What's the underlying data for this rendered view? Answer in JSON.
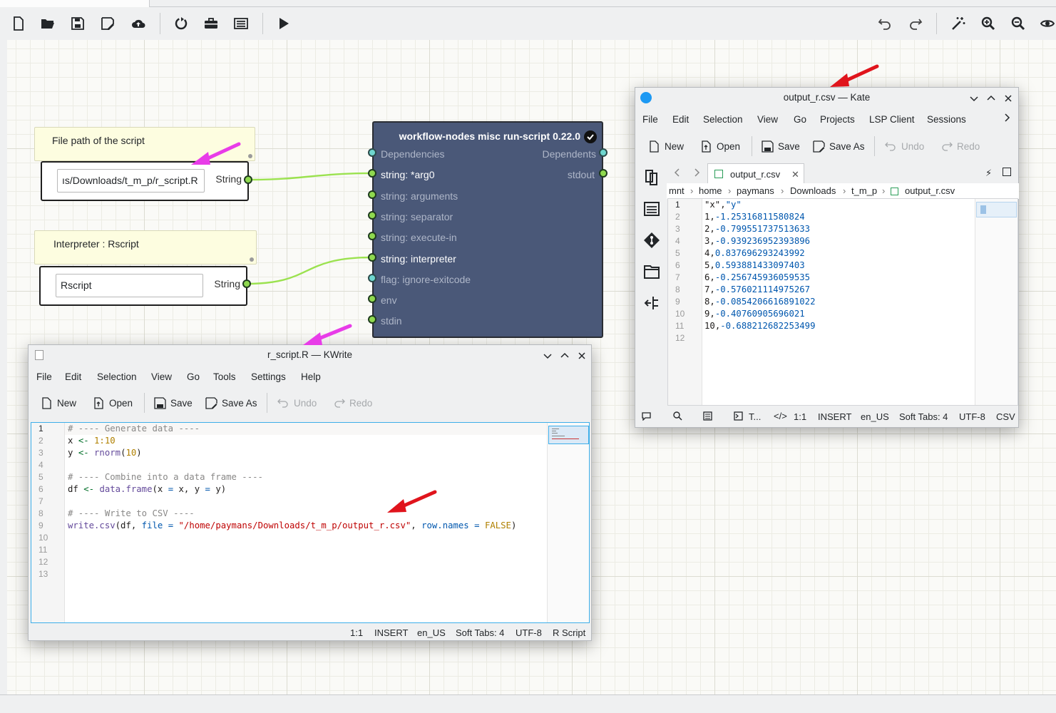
{
  "toolbar": {
    "left_icons": [
      "new-file-icon",
      "open-folder-icon",
      "save-icon",
      "save-as-icon",
      "upload-cloud-icon",
      "restart-icon",
      "toolbox-icon",
      "list-icon",
      "run-icon"
    ],
    "right_icons": [
      "undo-icon",
      "redo-icon",
      "magic-wand-icon",
      "zoom-in-icon",
      "zoom-out-icon",
      "visibility-icon"
    ]
  },
  "notes": {
    "script_path": "File path of the script",
    "interpreter": "Interpreter : Rscript"
  },
  "string_nodes": {
    "path_value": "ıs/Downloads/t_m_p/r_script.R",
    "path_type": "String",
    "interp_value": "Rscript",
    "interp_type": "String"
  },
  "run_script_node": {
    "title": "workflow-nodes misc run-script 0.22.0",
    "inputs": [
      "Dependencies",
      "string: *arg0",
      "string: arguments",
      "string: separator",
      "string: execute-in",
      "string: interpreter",
      "flag: ignore-exitcode",
      "env",
      "stdin"
    ],
    "outputs": [
      "Dependents",
      "stdout"
    ]
  },
  "kwrite": {
    "title": "r_script.R — KWrite",
    "menu": [
      "File",
      "Edit",
      "Selection",
      "View",
      "Go",
      "Tools",
      "Settings",
      "Help"
    ],
    "tools": [
      "New",
      "Open",
      "Save",
      "Save As",
      "Undo",
      "Redo"
    ],
    "line_numbers": [
      "1",
      "2",
      "3",
      "4",
      "5",
      "6",
      "7",
      "8",
      "9",
      "10",
      "11",
      "12",
      "13"
    ],
    "code": {
      "l1": "# ---- Generate data ----",
      "l2_a": "x ",
      "l2_op": "<-",
      "l2_sp": " ",
      "l2_num": "1:10",
      "l3_a": "y ",
      "l3_op": "<-",
      "l3_sp": " ",
      "l3_fn": "rnorm",
      "l3_p1": "(",
      "l3_num": "10",
      "l3_p2": ")",
      "l5": "# ---- Combine into a data frame ----",
      "l6_a": "df ",
      "l6_op": "<-",
      "l6_sp": " ",
      "l6_fn": "data.frame",
      "l6_p1": "(x ",
      "l6_eq1": "=",
      "l6_b": " x, y ",
      "l6_eq2": "=",
      "l6_c": " y)",
      "l8": "# ---- Write to CSV ----",
      "l9_fn": "write.csv",
      "l9_a": "(df, ",
      "l9_arg1": "file",
      "l9_eq1": " = ",
      "l9_str": "\"/home/paymans/Downloads/t_m_p/output_r.csv\"",
      "l9_b": ", ",
      "l9_arg2": "row.names",
      "l9_eq2": " = ",
      "l9_kw": "FALSE",
      "l9_c": ")"
    },
    "status": {
      "pos": "1:1",
      "mode": "INSERT",
      "lang": "en_US",
      "tabs": "Soft Tabs: 4",
      "enc": "UTF-8",
      "syntax": "R Script"
    }
  },
  "kate": {
    "title": "output_r.csv — Kate",
    "menu": [
      "File",
      "Edit",
      "Selection",
      "View",
      "Go",
      "Projects",
      "LSP Client",
      "Sessions"
    ],
    "tools": [
      "New",
      "Open",
      "Save",
      "Save As",
      "Undo",
      "Redo"
    ],
    "tab_label": "output_r.csv",
    "breadcrumb": [
      "mnt",
      "home",
      "paymans",
      "Downloads",
      "t_m_p",
      "output_r.csv"
    ],
    "line_numbers": [
      "1",
      "2",
      "3",
      "4",
      "5",
      "6",
      "7",
      "8",
      "9",
      "10",
      "11",
      "12"
    ],
    "csv_header": [
      "\"x\"",
      ",",
      "\"y\""
    ],
    "csv_rows": [
      [
        "1",
        ",",
        "-1.25316811580824"
      ],
      [
        "2",
        ",",
        "-0.799551737513633"
      ],
      [
        "3",
        ",",
        "-0.939236952393896"
      ],
      [
        "4",
        ",",
        "0.837696293243992"
      ],
      [
        "5",
        ",",
        "0.593881433097403"
      ],
      [
        "6",
        ",",
        "-0.256745936059535"
      ],
      [
        "7",
        ",",
        "-0.576021114975267"
      ],
      [
        "8",
        ",",
        "-0.0854206616891022"
      ],
      [
        "9",
        ",",
        "-0.40760905696021"
      ],
      [
        "10",
        ",",
        "-0.688212682253499"
      ]
    ],
    "status": {
      "term": "T...",
      "pos": "1:1",
      "mode": "INSERT",
      "lang": "en_US",
      "tabs": "Soft Tabs: 4",
      "enc": "UTF-8",
      "syntax": "CSV"
    }
  },
  "colors": {
    "node_body": "#4a5878",
    "wire": "#9be24f",
    "port_green": "#8fd94f",
    "port_cyan": "#6fd6cf",
    "arrow_red": "#e0141c",
    "arrow_magenta": "#e83ce8",
    "note_bg": "#fdfde0"
  }
}
